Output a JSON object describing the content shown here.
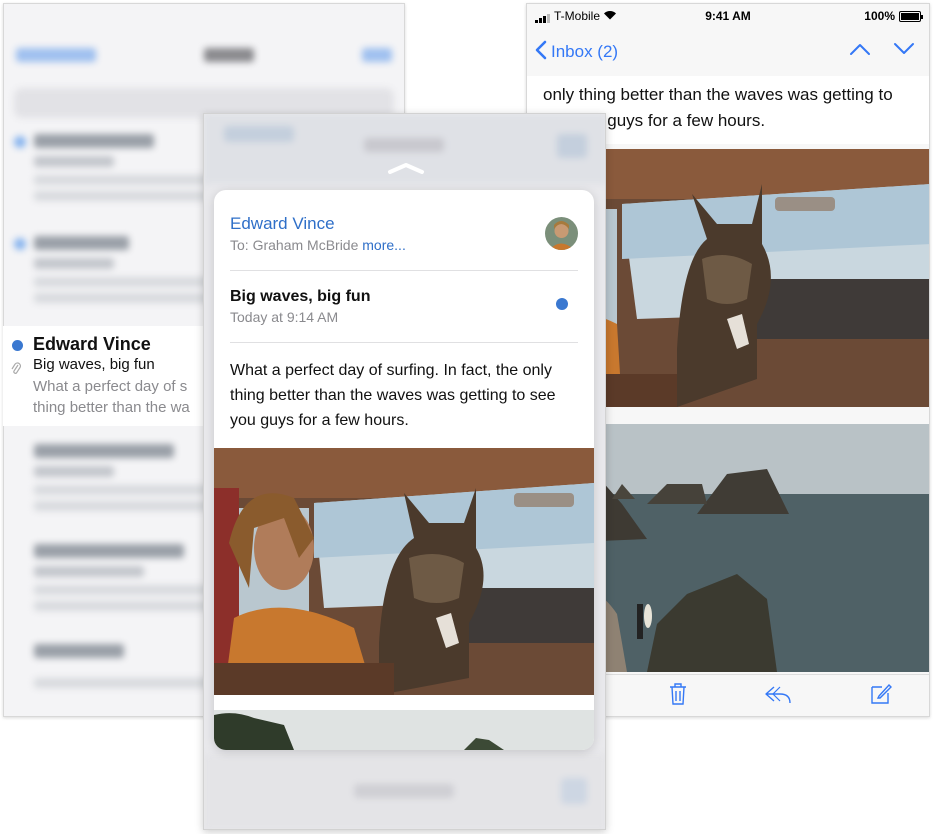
{
  "left_list": {
    "highlighted_message": {
      "sender": "Edward Vince",
      "subject": "Big waves, big fun",
      "preview_line1": "What a perfect day of s",
      "preview_line2": "thing better than the wa"
    }
  },
  "right_screen": {
    "status_bar": {
      "carrier": "T-Mobile",
      "time": "9:41 AM",
      "battery": "100%"
    },
    "nav": {
      "back_label": "Inbox (2)"
    },
    "body_text": "only thing better than the waves was getting to see you guys for a few hours."
  },
  "peek_card": {
    "sender": "Edward Vince",
    "to_label": "To: Graham McBride",
    "more_label": "more...",
    "subject": "Big waves, big fun",
    "timestamp": "Today at 9:14 AM",
    "body": "What a perfect day of surfing. In fact, the only thing better than the waves was getting to see you guys for a few hours."
  },
  "icons": {
    "toolbar": [
      "folder-icon",
      "trash-icon",
      "reply-icon",
      "compose-icon"
    ],
    "nav_arrows": [
      "chevron-up-icon",
      "chevron-down-icon"
    ]
  },
  "colors": {
    "accent": "#3478f6",
    "sender_link": "#2f6fc8",
    "unread_dot": "#3a78d0"
  }
}
